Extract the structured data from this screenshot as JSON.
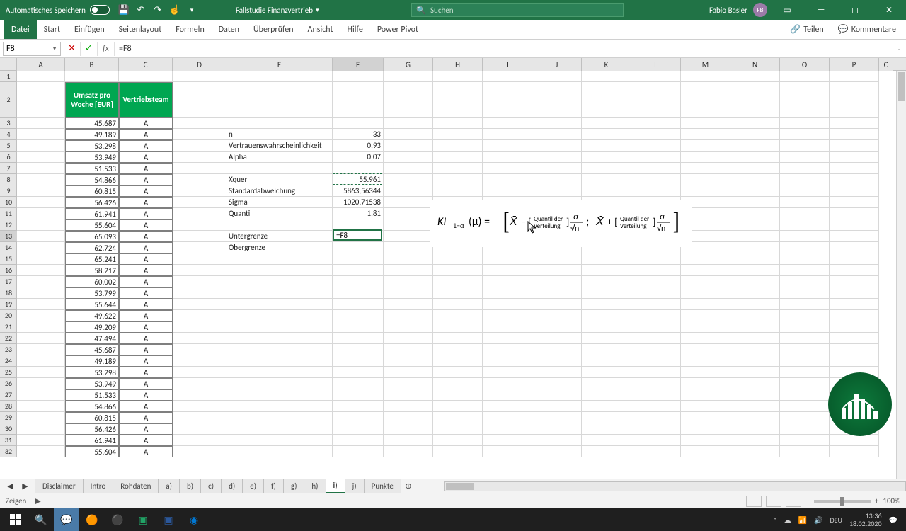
{
  "title_bar": {
    "autosave_label": "Automatisches Speichern",
    "doc_title": "Fallstudie Finanzvertrieb",
    "search_placeholder": "Suchen",
    "user_name": "Fabio Basler",
    "user_initials": "FB"
  },
  "ribbon": {
    "tabs": [
      "Datei",
      "Start",
      "Einfügen",
      "Seitenlayout",
      "Formeln",
      "Daten",
      "Überprüfen",
      "Ansicht",
      "Hilfe",
      "Power Pivot"
    ],
    "share": "Teilen",
    "comments": "Kommentare"
  },
  "formula_bar": {
    "name_box": "F8",
    "formula": "=F8"
  },
  "columns": [
    "A",
    "B",
    "C",
    "D",
    "E",
    "F",
    "G",
    "H",
    "I",
    "J",
    "K",
    "L",
    "M",
    "N",
    "O",
    "P",
    "C"
  ],
  "table": {
    "header_b": "Umsatz pro Woche [EUR]",
    "header_c": "Vertriebsteam",
    "rows": [
      {
        "b": "45.687",
        "c": "A"
      },
      {
        "b": "49.189",
        "c": "A"
      },
      {
        "b": "53.298",
        "c": "A"
      },
      {
        "b": "53.949",
        "c": "A"
      },
      {
        "b": "51.533",
        "c": "A"
      },
      {
        "b": "54.866",
        "c": "A"
      },
      {
        "b": "60.815",
        "c": "A"
      },
      {
        "b": "56.426",
        "c": "A"
      },
      {
        "b": "61.941",
        "c": "A"
      },
      {
        "b": "55.604",
        "c": "A"
      },
      {
        "b": "65.093",
        "c": "A"
      },
      {
        "b": "62.724",
        "c": "A"
      },
      {
        "b": "65.241",
        "c": "A"
      },
      {
        "b": "58.217",
        "c": "A"
      },
      {
        "b": "60.002",
        "c": "A"
      },
      {
        "b": "53.799",
        "c": "A"
      },
      {
        "b": "55.644",
        "c": "A"
      },
      {
        "b": "49.622",
        "c": "A"
      },
      {
        "b": "49.209",
        "c": "A"
      },
      {
        "b": "47.494",
        "c": "A"
      },
      {
        "b": "45.687",
        "c": "A"
      },
      {
        "b": "49.189",
        "c": "A"
      },
      {
        "b": "53.298",
        "c": "A"
      },
      {
        "b": "53.949",
        "c": "A"
      },
      {
        "b": "51.533",
        "c": "A"
      },
      {
        "b": "54.866",
        "c": "A"
      },
      {
        "b": "60.815",
        "c": "A"
      },
      {
        "b": "56.426",
        "c": "A"
      },
      {
        "b": "61.941",
        "c": "A"
      },
      {
        "b": "55.604",
        "c": "A"
      }
    ]
  },
  "stats": {
    "n_label": "n",
    "n": "33",
    "conf_label": "Vertrauenswahrscheinlichkeit",
    "conf": "0,93",
    "alpha_label": "Alpha",
    "alpha": "0,07",
    "xquer_label": "Xquer",
    "xquer": "55.961",
    "std_label": "Standardabweichung",
    "std": "5863,56344",
    "sigma_label": "Sigma",
    "sigma": "1020,71538",
    "quantil_label": "Quantil",
    "quantil": "1,81",
    "lower_label": "Untergrenze",
    "lower": "=F8",
    "upper_label": "Obergrenze",
    "upper": ""
  },
  "sheet_tabs": [
    "Disclaimer",
    "Intro",
    "Rohdaten",
    "a)",
    "b)",
    "c)",
    "d)",
    "e)",
    "f)",
    "g)",
    "h)",
    "i)",
    "j)",
    "Punkte"
  ],
  "active_sheet": "i)",
  "status": {
    "mode": "Zeigen",
    "zoom": "100%"
  },
  "taskbar": {
    "lang": "DEU",
    "time": "13:36",
    "date": "18.02.2020"
  },
  "formula_text": {
    "q1": "Quantil der",
    "q2": "Verteilung"
  }
}
